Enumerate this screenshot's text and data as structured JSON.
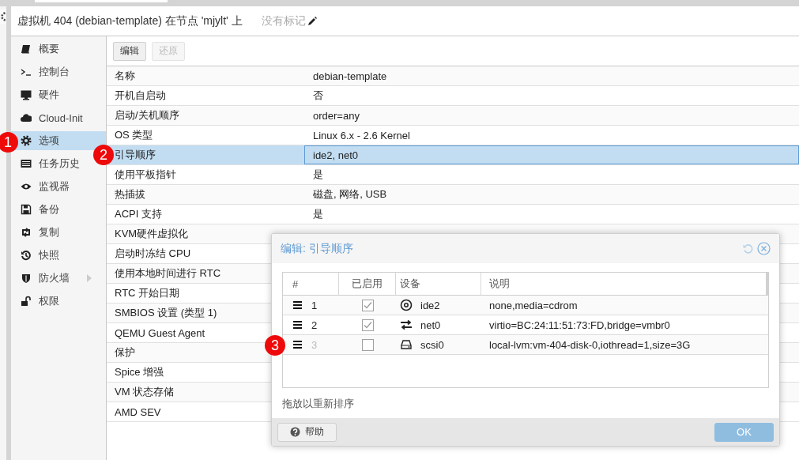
{
  "header": {
    "title": "虚拟机 404 (debian-template) 在节点 'mjylt' 上",
    "tags": "没有标记"
  },
  "sidebar": {
    "items": [
      {
        "label": "概要",
        "selected": false,
        "expandable": false
      },
      {
        "label": "控制台",
        "selected": false,
        "expandable": false
      },
      {
        "label": "硬件",
        "selected": false,
        "expandable": false
      },
      {
        "label": "Cloud-Init",
        "selected": false,
        "expandable": false
      },
      {
        "label": "选项",
        "selected": true,
        "expandable": false
      },
      {
        "label": "任务历史",
        "selected": false,
        "expandable": false
      },
      {
        "label": "监视器",
        "selected": false,
        "expandable": false
      },
      {
        "label": "备份",
        "selected": false,
        "expandable": false
      },
      {
        "label": "复制",
        "selected": false,
        "expandable": false
      },
      {
        "label": "快照",
        "selected": false,
        "expandable": false
      },
      {
        "label": "防火墙",
        "selected": false,
        "expandable": true
      },
      {
        "label": "权限",
        "selected": false,
        "expandable": false
      }
    ]
  },
  "toolbar": {
    "buttons": [
      {
        "label": "编辑",
        "disabled": false
      },
      {
        "label": "还原",
        "disabled": true
      }
    ]
  },
  "options": {
    "rows": [
      {
        "name": "名称",
        "value": "debian-template",
        "selected": false
      },
      {
        "name": "开机自启动",
        "value": "否",
        "selected": false
      },
      {
        "name": "启动/关机顺序",
        "value": "order=any",
        "selected": false
      },
      {
        "name": "OS 类型",
        "value": "Linux 6.x - 2.6 Kernel",
        "selected": false
      },
      {
        "name": "引导顺序",
        "value": "ide2, net0",
        "selected": true
      },
      {
        "name": "使用平板指针",
        "value": "是",
        "selected": false
      },
      {
        "name": "热插拔",
        "value": "磁盘, 网络, USB",
        "selected": false
      },
      {
        "name": "ACPI 支持",
        "value": "是",
        "selected": false
      },
      {
        "name": "KVM硬件虚拟化",
        "selected": false
      },
      {
        "name": "启动时冻结 CPU",
        "selected": false
      },
      {
        "name": "使用本地时间进行 RTC",
        "selected": false
      },
      {
        "name": "RTC 开始日期",
        "selected": false
      },
      {
        "name": "SMBIOS 设置 (类型 1)",
        "selected": false
      },
      {
        "name": "QEMU Guest Agent",
        "selected": false
      },
      {
        "name": "保护",
        "selected": false
      },
      {
        "name": "Spice 增强",
        "selected": false
      },
      {
        "name": "VM 状态存储",
        "selected": false
      },
      {
        "name": "AMD SEV",
        "selected": false
      }
    ]
  },
  "dialog": {
    "title": "编辑: 引导顺序",
    "columns": [
      "#",
      "已启用",
      "设备",
      "说明"
    ],
    "rows": [
      {
        "number": "1",
        "enabled": true,
        "device": "ide2",
        "description": "none,media=cdrom"
      },
      {
        "number": "2",
        "enabled": true,
        "device": "net0",
        "description": "virtio=BC:24:11:51:73:FD,bridge=vmbr0"
      },
      {
        "number": "3",
        "enabled": false,
        "device": "scsi0",
        "description": "local-lvm:vm-404-disk-0,iothread=1,size=3G"
      }
    ],
    "hint": "拖放以重新排序",
    "buttons": [
      {
        "label": "帮助",
        "kind": "help",
        "disabled": false
      },
      {
        "label": "OK",
        "kind": "primary",
        "disabled": true
      }
    ]
  },
  "markers": [
    {
      "label": "1"
    },
    {
      "label": "2"
    },
    {
      "label": "3"
    }
  ]
}
